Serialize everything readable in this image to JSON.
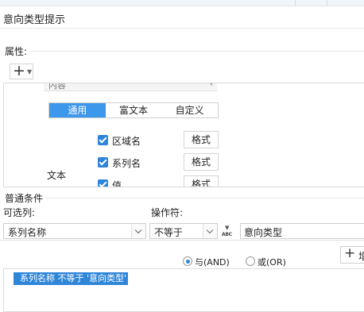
{
  "dialog": {
    "title": "意向类型提示"
  },
  "properties": {
    "label": "属性:",
    "add_button": {
      "icon": "plus-icon"
    },
    "content_field": "内容",
    "tabs": [
      {
        "label": "通用",
        "active": true
      },
      {
        "label": "富文本",
        "active": false
      },
      {
        "label": "自定义",
        "active": false
      }
    ],
    "text_group_label": "文本",
    "checkboxes": [
      {
        "label": "区域名",
        "checked": true,
        "format_label": "格式"
      },
      {
        "label": "系列名",
        "checked": true,
        "format_label": "格式"
      },
      {
        "label": "值",
        "checked": true,
        "format_label": "格式"
      }
    ]
  },
  "condition": {
    "section_label": "普通条件",
    "column_label": "可选列:",
    "column_value": "系列名称",
    "operator_label": "操作符:",
    "operator_value": "不等于",
    "value": "意向类型",
    "value_type_icon": "abc-type-icon",
    "logic": [
      {
        "label": "与(AND)",
        "selected": true
      },
      {
        "label": "或(OR)",
        "selected": false
      }
    ],
    "add_button_label": "增",
    "items": [
      "系列名称 不等于 '意向类型'"
    ]
  },
  "colors": {
    "accent": "#3d97ea",
    "selection": "#2f86d8"
  }
}
